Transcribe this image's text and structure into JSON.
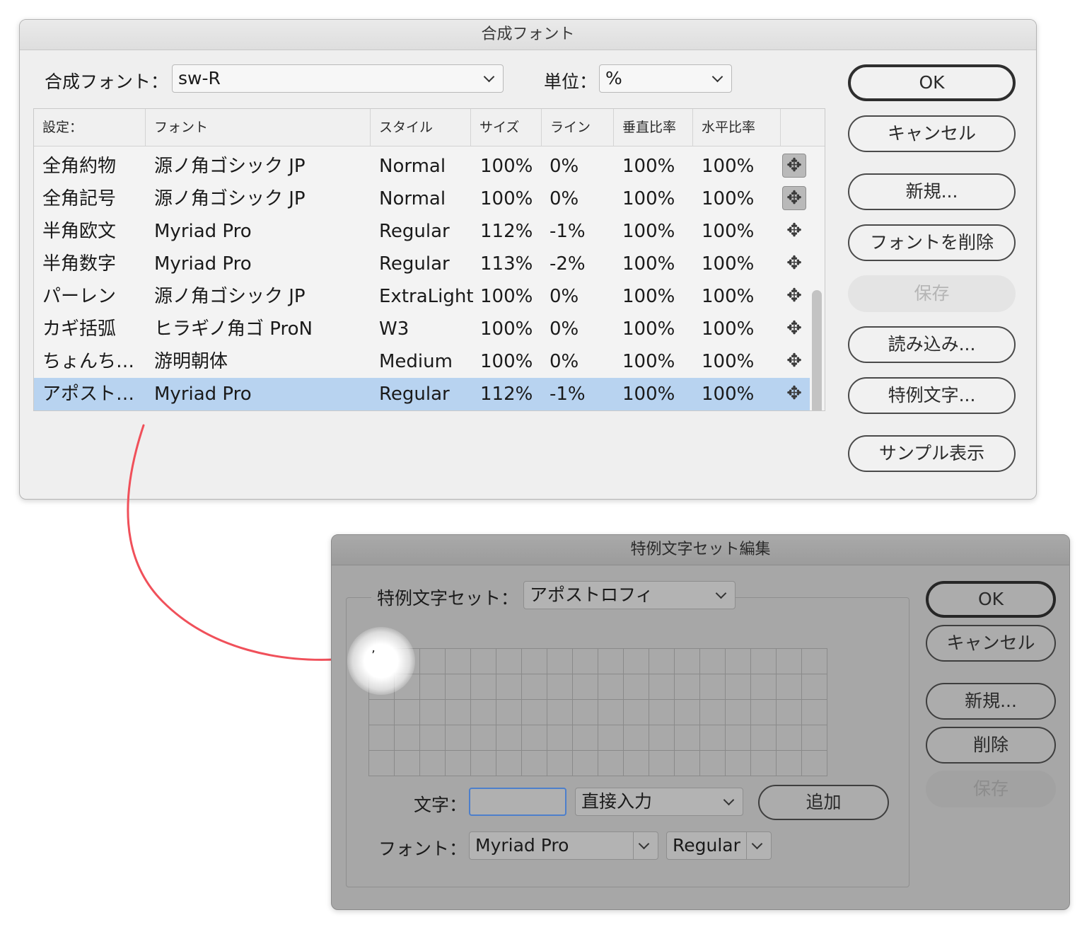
{
  "composite_dialog": {
    "title": "合成フォント",
    "font_label": "合成フォント：",
    "font_value": "sw-R",
    "unit_label": "単位：",
    "unit_value": "%",
    "columns": [
      "設定：",
      "フォント",
      "スタイル",
      "サイズ",
      "ライン",
      "垂直比率",
      "水平比率"
    ],
    "rows": [
      {
        "setting": "全角約物",
        "font": "源ノ角ゴシック JP",
        "style": "Normal",
        "size": "100%",
        "line": "0%",
        "vscale": "100%",
        "hscale": "100%"
      },
      {
        "setting": "全角記号",
        "font": "源ノ角ゴシック JP",
        "style": "Normal",
        "size": "100%",
        "line": "0%",
        "vscale": "100%",
        "hscale": "100%"
      },
      {
        "setting": "半角欧文",
        "font": "Myriad Pro",
        "style": "Regular",
        "size": "112%",
        "line": "-1%",
        "vscale": "100%",
        "hscale": "100%"
      },
      {
        "setting": "半角数字",
        "font": "Myriad Pro",
        "style": "Regular",
        "size": "113%",
        "line": "-2%",
        "vscale": "100%",
        "hscale": "100%"
      },
      {
        "setting": "パーレン",
        "font": "源ノ角ゴシック JP",
        "style": "ExtraLight",
        "size": "100%",
        "line": "0%",
        "vscale": "100%",
        "hscale": "100%"
      },
      {
        "setting": "カギ括弧",
        "font": "ヒラギノ角ゴ ProN",
        "style": "W3",
        "size": "100%",
        "line": "0%",
        "vscale": "100%",
        "hscale": "100%"
      },
      {
        "setting": "ちょんち…",
        "font": "游明朝体",
        "style": "Medium",
        "size": "100%",
        "line": "0%",
        "vscale": "100%",
        "hscale": "100%"
      },
      {
        "setting": "アポスト…",
        "font": "Myriad Pro",
        "style": "Regular",
        "size": "112%",
        "line": "-1%",
        "vscale": "100%",
        "hscale": "100%"
      }
    ],
    "buttons": {
      "ok": "OK",
      "cancel": "キャンセル",
      "new": "新規...",
      "delete_font": "フォントを削除",
      "save": "保存",
      "load": "読み込み...",
      "exception": "特例文字...",
      "sample": "サンプル表示"
    }
  },
  "exception_dialog": {
    "title": "特例文字セット編集",
    "set_label": "特例文字セット：",
    "set_value": "アポストロフィ",
    "grid_char": "’",
    "char_label": "文字：",
    "char_value": "",
    "input_mode": "直接入力",
    "add_button": "追加",
    "font_label": "フォント：",
    "font_value": "Myriad Pro",
    "style_value": "Regular",
    "buttons": {
      "ok": "OK",
      "cancel": "キャンセル",
      "new": "新規...",
      "delete": "削除",
      "save": "保存"
    }
  },
  "colors": {
    "selection": "#b8d3f0",
    "arrow": "#f0505a"
  }
}
